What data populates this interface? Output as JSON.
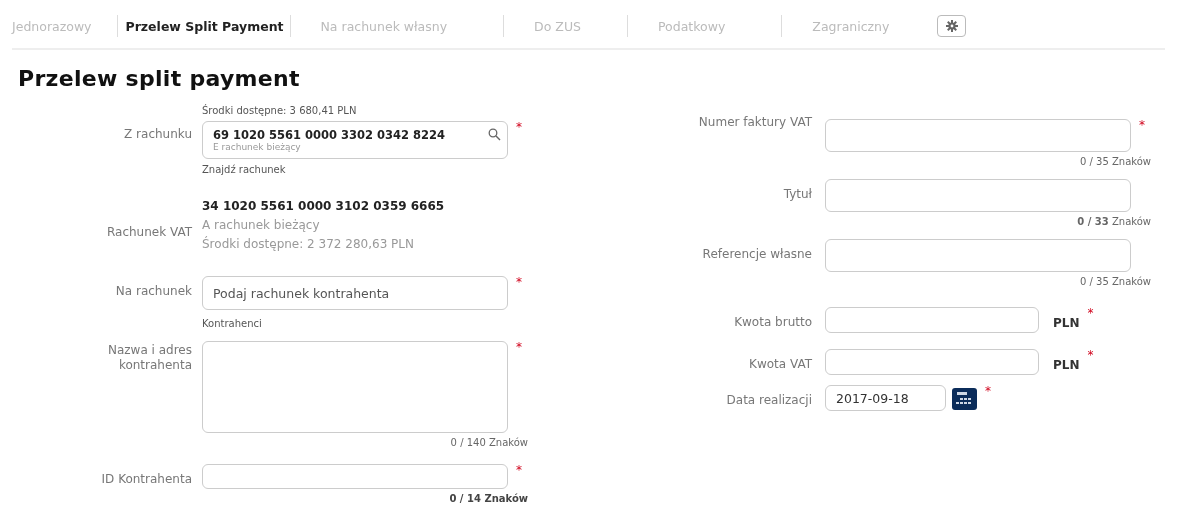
{
  "tabs": [
    {
      "label": "Jednorazowy",
      "selected": false
    },
    {
      "label": "Przelew Split Payment",
      "selected": true
    },
    {
      "label": "Na rachunek własny",
      "selected": false
    },
    {
      "label": "Do ZUS",
      "selected": false
    },
    {
      "label": "Podatkowy",
      "selected": false
    },
    {
      "label": "Zagraniczny",
      "selected": false
    }
  ],
  "page_title": "Przelew split payment",
  "left_fields": [
    {
      "kind": "account",
      "label": "Z rachunku",
      "above": "Środki dostępne: 3 680,41 PLN",
      "value": "69 1020 5561 0000 3302 0342 8224",
      "account_type": "E rachunek bieżący",
      "required_mark": "*",
      "link": "Znajdź rachunek"
    },
    {
      "kind": "info",
      "label": "Rachunek VAT",
      "lines": [
        "34 1020 5561 0000 3102 0359 6665",
        "A rachunek bieżący",
        "Środki dostępne: 2 372 280,63 PLN"
      ]
    },
    {
      "kind": "input",
      "label": "Na rachunek",
      "placeholder": "Podaj rachunek kontrahenta",
      "required_mark": "*",
      "link": "Kontrahenci"
    },
    {
      "kind": "textarea",
      "label": "Nazwa i adres kontrahenta",
      "required_mark": "*",
      "counter": "0 / 140 Znaków",
      "counter_bold": false
    },
    {
      "kind": "input",
      "label": "ID Kontrahenta",
      "required_mark": "*",
      "counter": "0 / 14 Znaków",
      "counter_bold": true
    }
  ],
  "right_fields": [
    {
      "kind": "input",
      "label": "Numer faktury VAT",
      "required_mark": "*",
      "counter": "0 / 35 Znaków",
      "counter_bold": false
    },
    {
      "kind": "input",
      "label": "Tytuł",
      "counter": "**0 / 33** Znaków",
      "counter_bold": false
    },
    {
      "kind": "input",
      "label": "Referencje własne",
      "counter": "0 / 35 Znaków",
      "counter_bold": false
    },
    {
      "kind": "amount",
      "label": "Kwota brutto",
      "unit": "PLN",
      "required_mark": "*"
    },
    {
      "kind": "amount",
      "label": "Kwota VAT",
      "unit": "PLN",
      "required_mark": "*"
    },
    {
      "kind": "date",
      "label": "Data realizacji",
      "value": "2017-09-18",
      "required_mark": "*"
    }
  ]
}
